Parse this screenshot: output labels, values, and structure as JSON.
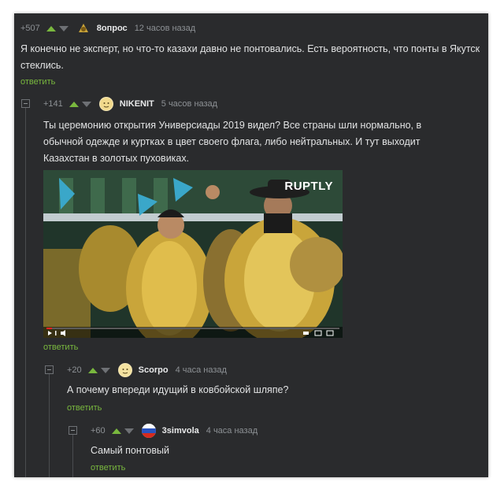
{
  "reply_label": "ответить",
  "comments": [
    {
      "rating": "+507",
      "author": "8опрос",
      "time": "12 часов назад",
      "text": "Я конечно не эксперт, но что-то казахи давно не понтовались. Есть вероятность, что понты в Якутск стеклись."
    },
    {
      "rating": "+141",
      "author": "NIKENIT",
      "time": "5 часов назад",
      "text": "Ты церемонию открытия Универсиады 2019 видел? Все страны шли нормально, в обычной одежде и куртках в цвет своего флага, либо нейтральных. И тут выходит Казахстан в золотых пуховиках.",
      "media": {
        "watermark": "RUPTLY",
        "progress": 0.02
      }
    },
    {
      "rating": "+20",
      "author": "Scorpo",
      "time": "4 часа назад",
      "text": "А почему впереди идущий в ковбойской шляпе?"
    },
    {
      "rating": "+60",
      "author": "3simvola",
      "time": "4 часа назад",
      "text": "Самый понтовый"
    }
  ],
  "colors": {
    "accent": "#79b83e",
    "background": "#2a2b2d",
    "text": "#e2e3e4",
    "muted": "#8d9195"
  }
}
